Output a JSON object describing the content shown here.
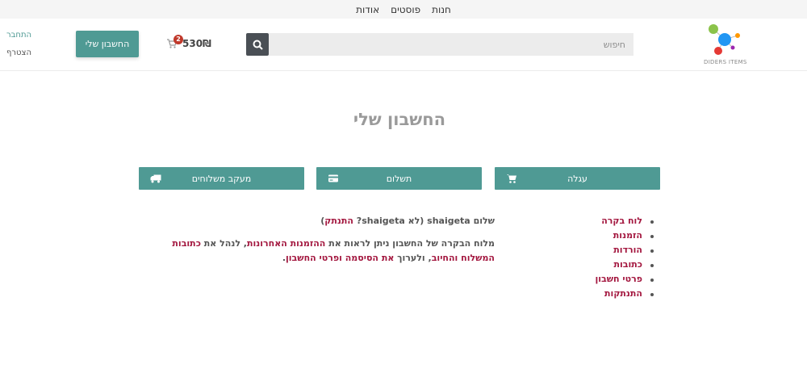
{
  "topnav": {
    "items": [
      "חנות",
      "פוסטים",
      "אודות"
    ]
  },
  "header": {
    "logo_text": "DIDERS ITEMS",
    "search": {
      "placeholder": "חיפוש"
    },
    "cart": {
      "count": "2",
      "total": "530₪"
    },
    "account_button": "החשבון שלי",
    "login": "התחבר",
    "register": "הצטרף"
  },
  "page": {
    "title": "החשבון שלי"
  },
  "tiles": [
    {
      "label": "עגלה",
      "icon": "cart-icon"
    },
    {
      "label": "תשלום",
      "icon": "credit-card-icon"
    },
    {
      "label": "מעקב משלוחים",
      "icon": "truck-icon"
    }
  ],
  "side_menu": [
    "לוח בקרה",
    "הזמנות",
    "הורדות",
    "כתובות",
    "פרטי חשבון",
    "התנתקות"
  ],
  "content": {
    "hello_prefix": "שלום ",
    "username": "shaigeta",
    "hello_mid": " (לא ",
    "hello_username2": "shaigeta",
    "hello_q": "? ",
    "logout_link": "התנתק",
    "hello_end": ")",
    "intro_1": "מלוח הבקרה של החשבון ניתן לראות את ",
    "link_orders": "ההזמנות האחרונות",
    "intro_2": ", לנהל את ",
    "link_addresses": "כתובות המשלוח והחיוב",
    "intro_3": ", ולערוך ",
    "link_details": "את הסיסמה ופרטי החשבון",
    "intro_4": "."
  },
  "colors": {
    "accent": "#4f9a94",
    "link": "#a3173f",
    "title": "#9a9a9a"
  }
}
